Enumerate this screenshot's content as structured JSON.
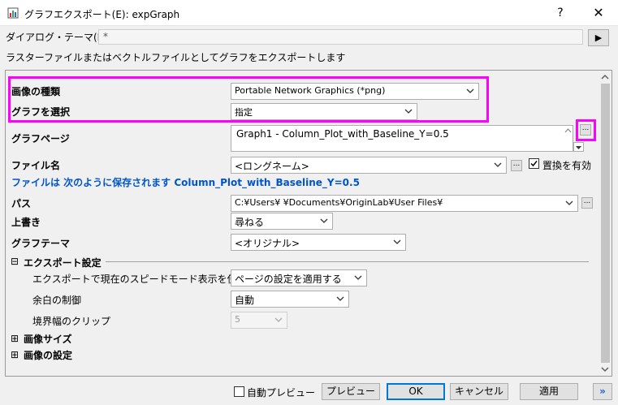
{
  "window": {
    "title": "グラフエクスポート(E): expGraph",
    "help": "?",
    "close": "✕"
  },
  "theme": {
    "label": "ダイアログ・テーマ(H)",
    "value": "*",
    "arrow": "▶"
  },
  "description": "ラスターファイルまたはベクトルファイルとしてグラフをエクスポートします",
  "form": {
    "image_type": {
      "label": "画像の種類",
      "value": "Portable Network Graphics (*png)"
    },
    "select_graph": {
      "label": "グラフを選択",
      "value": "指定"
    },
    "graph_page": {
      "label": "グラフページ",
      "value": "Graph1 - Column_Plot_with_Baseline_Y=0.5",
      "browse": "..."
    },
    "file_name": {
      "label": "ファイル名",
      "value": "<ロングネーム>",
      "browse": "...",
      "replace_label": "置換を有効",
      "replace_checked": true
    },
    "save_notice": "ファイルは 次のように保存されます Column_Plot_with_Baseline_Y=0.5",
    "path": {
      "label": "パス",
      "value": "C:¥Users¥          ¥Documents¥OriginLab¥User Files¥",
      "browse": "..."
    },
    "overwrite": {
      "label": "上書き",
      "value": "尋ねる"
    },
    "graph_theme": {
      "label": "グラフテーマ",
      "value": "<オリジナル>"
    },
    "export_settings": {
      "label": "エクスポート設定",
      "expander": "⊟",
      "speed_mode": {
        "label": "エクスポートで現在のスピードモード表示を使う",
        "value": "ページの設定を適用する"
      },
      "margin": {
        "label": "余白の制御",
        "value": "自動"
      },
      "clip": {
        "label": "境界幅のクリップ",
        "value": "5"
      }
    },
    "image_size": {
      "label": "画像サイズ",
      "expander": "⊞"
    },
    "image_settings": {
      "label": "画像の設定",
      "expander": "⊞"
    }
  },
  "footer": {
    "auto_preview": "自動プレビュー",
    "preview": "プレビュー",
    "ok": "OK",
    "cancel": "キャンセル",
    "apply": "適用",
    "more": "»"
  },
  "colors": {
    "highlight": "#ff00ff",
    "blue_text": "#0055cc",
    "default_button_border": "#0078d7"
  }
}
